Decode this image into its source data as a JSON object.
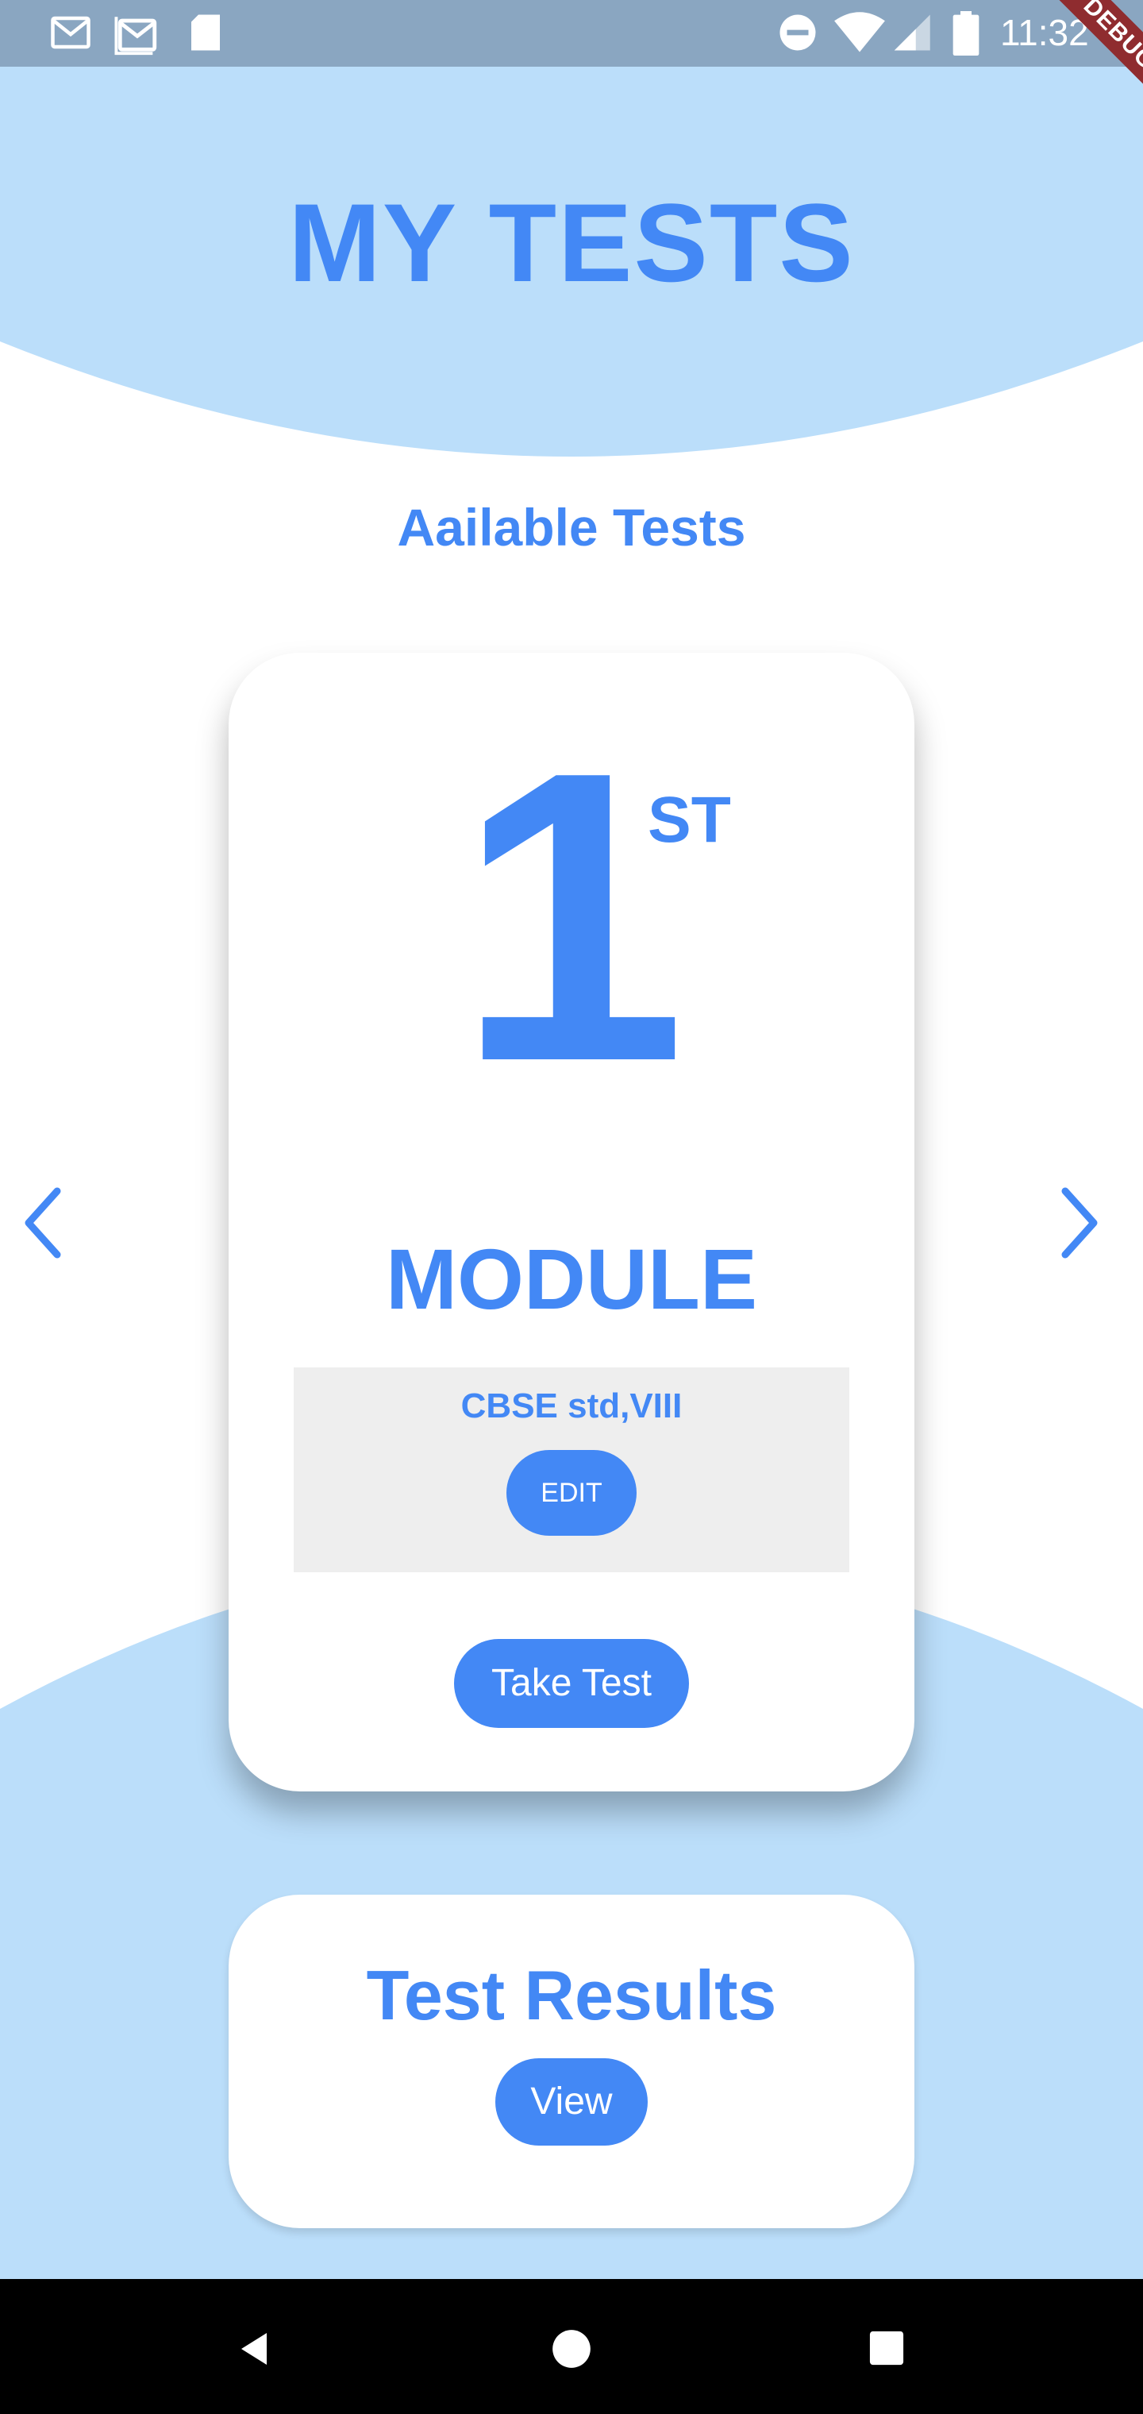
{
  "status_bar": {
    "time": "11:32",
    "left_icons": [
      "gmail-icon",
      "gmail-icon",
      "sd-card-icon"
    ],
    "right_icons": [
      "do-not-disturb-icon",
      "wifi-icon",
      "signal-icon",
      "battery-icon"
    ]
  },
  "debug_banner": "DEBUG",
  "header": {
    "title": "MY TESTS"
  },
  "section": {
    "title": "Aailable Tests"
  },
  "module_card": {
    "number": "1",
    "ordinal": "ST",
    "label": "MODULE",
    "info_text": "CBSE std,VIII",
    "edit_label": "EDIT",
    "take_test_label": "Take Test"
  },
  "results_card": {
    "title": "Test Results",
    "view_label": "View"
  },
  "navigation": {
    "prev_icon": "chevron-left-icon",
    "next_icon": "chevron-right-icon",
    "system_buttons": [
      "back-icon",
      "home-icon",
      "recents-icon"
    ]
  },
  "colors": {
    "accent": "#4388f5",
    "light_blue": "#bbdefa",
    "status_bar": "#8aa6c1",
    "info_box": "#eeeeee"
  }
}
